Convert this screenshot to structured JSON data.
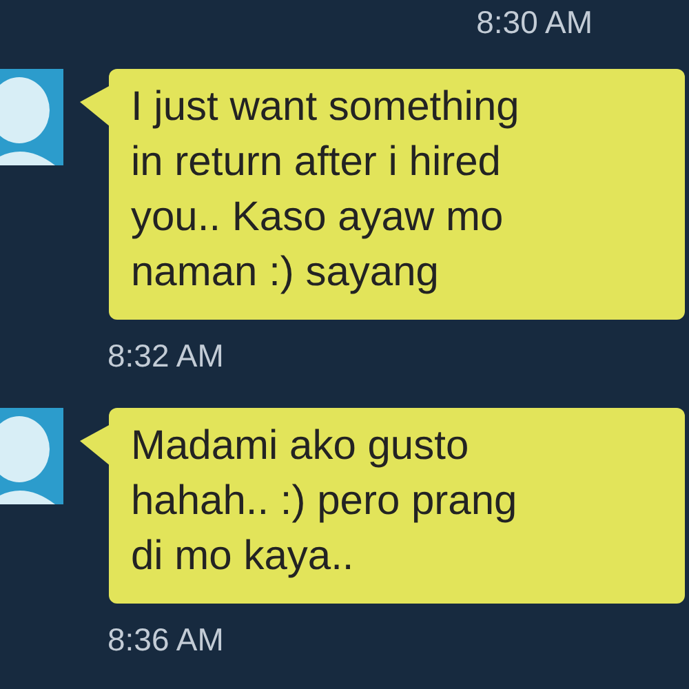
{
  "header_time": "8:30 AM",
  "messages": [
    {
      "text": "I just want something in return after i hired you.. Kaso ayaw mo naman :) sayang",
      "time": "8:32 AM"
    },
    {
      "text": "Madami ako gusto hahah.. :) pero prang di mo kaya..",
      "time": "8:36 AM"
    }
  ]
}
